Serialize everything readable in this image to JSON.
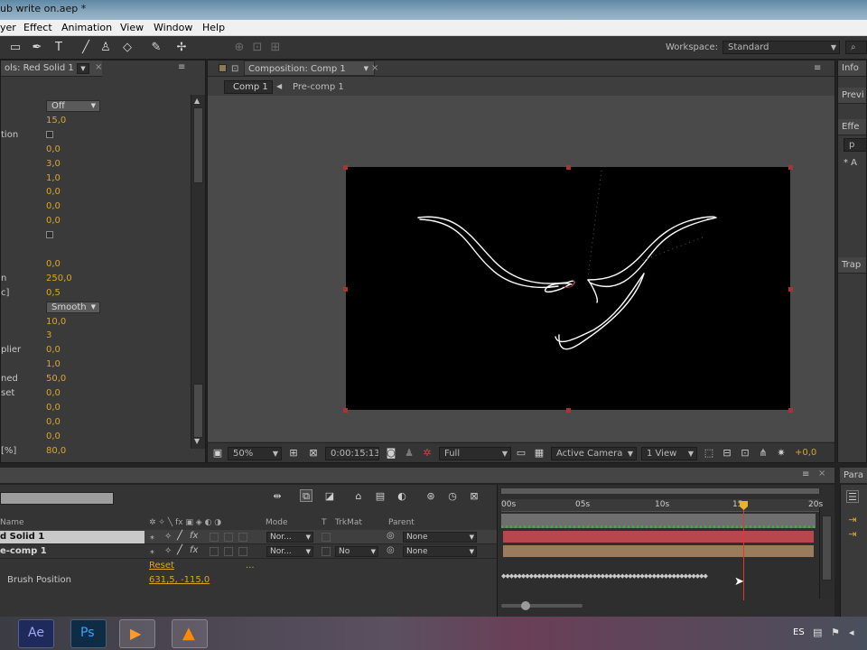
{
  "window": {
    "title": "ub write on.aep *"
  },
  "menu": [
    "yer",
    "Effect",
    "Animation",
    "View",
    "Window",
    "Help"
  ],
  "toolbar": {
    "workspace_label": "Workspace:",
    "workspace_value": "Standard"
  },
  "effect_controls": {
    "tab_label": "ols: Red Solid 1",
    "rows": [
      {
        "name": "",
        "kind": "select",
        "value": "Off"
      },
      {
        "name": "",
        "kind": "value",
        "value": "15,0"
      },
      {
        "name": "tion",
        "kind": "check",
        "value": ""
      },
      {
        "name": "",
        "kind": "value",
        "value": "0,0"
      },
      {
        "name": "",
        "kind": "value",
        "value": "3,0"
      },
      {
        "name": "",
        "kind": "value",
        "value": "1,0"
      },
      {
        "name": "",
        "kind": "value",
        "value": "0,0"
      },
      {
        "name": "",
        "kind": "value",
        "value": "0,0"
      },
      {
        "name": "",
        "kind": "value",
        "value": "0,0"
      },
      {
        "name": "",
        "kind": "check",
        "value": ""
      },
      {
        "name": "",
        "kind": "value",
        "value": ""
      },
      {
        "name": "",
        "kind": "value",
        "value": "0,0"
      },
      {
        "name": "n",
        "kind": "value",
        "value": "250,0"
      },
      {
        "name": "c]",
        "kind": "value",
        "value": "0,5"
      },
      {
        "name": "",
        "kind": "select",
        "value": "Smooth"
      },
      {
        "name": "",
        "kind": "value",
        "value": "10,0"
      },
      {
        "name": "",
        "kind": "value",
        "value": "3"
      },
      {
        "name": "plier",
        "kind": "value",
        "value": "0,0"
      },
      {
        "name": "",
        "kind": "value",
        "value": "1,0"
      },
      {
        "name": "ned",
        "kind": "value",
        "value": "50,0"
      },
      {
        "name": "set",
        "kind": "value",
        "value": "0,0"
      },
      {
        "name": "",
        "kind": "value",
        "value": "0,0"
      },
      {
        "name": "",
        "kind": "value",
        "value": "0,0"
      },
      {
        "name": "",
        "kind": "value",
        "value": "0,0"
      },
      {
        "name": "[%]",
        "kind": "value",
        "value": "80,0"
      }
    ]
  },
  "composition": {
    "tab_label": "Composition: Comp 1",
    "breadcrumbs": [
      "Comp 1",
      "Pre-comp 1"
    ],
    "zoom": "50%",
    "timecode": "0:00:15:13",
    "resolution": "Full",
    "camera": "Active Camera",
    "views": "1 View",
    "exposure": "+0,0"
  },
  "right_panels": {
    "info_tab": "Info",
    "preview_tab": "Previ",
    "effects_tab": "Effe",
    "search_text": "p",
    "tree_items": [
      "* A",
      ""
    ],
    "trap_tab": "Trap"
  },
  "timeline": {
    "columns": {
      "name": "Name",
      "mode": "Mode",
      "t": "T",
      "trkmat": "TrkMat",
      "parent": "Parent"
    },
    "layers": [
      {
        "name": "d Solid 1",
        "mode": "Nor...",
        "trkmat": "",
        "parent": "None"
      },
      {
        "name": "e-comp 1",
        "mode": "Nor...",
        "trkmat": "No",
        "parent": "None"
      }
    ],
    "reset_label": "Reset",
    "reset_dots": "...",
    "property_name": "Brush Position",
    "property_value": "631,5, -115,0",
    "ruler": [
      "00s",
      "05s",
      "10s",
      "15s",
      "20s"
    ],
    "para_tab": "Para"
  },
  "taskbar": {
    "lang": "ES",
    "apps": [
      "Ae",
      "Ps",
      "",
      ""
    ]
  },
  "colors": {
    "accent_orange": "#d9a52a",
    "layer1_bar": "#b8464e",
    "layer2_bar": "#9a7b5e",
    "playhead": "#e63535"
  }
}
